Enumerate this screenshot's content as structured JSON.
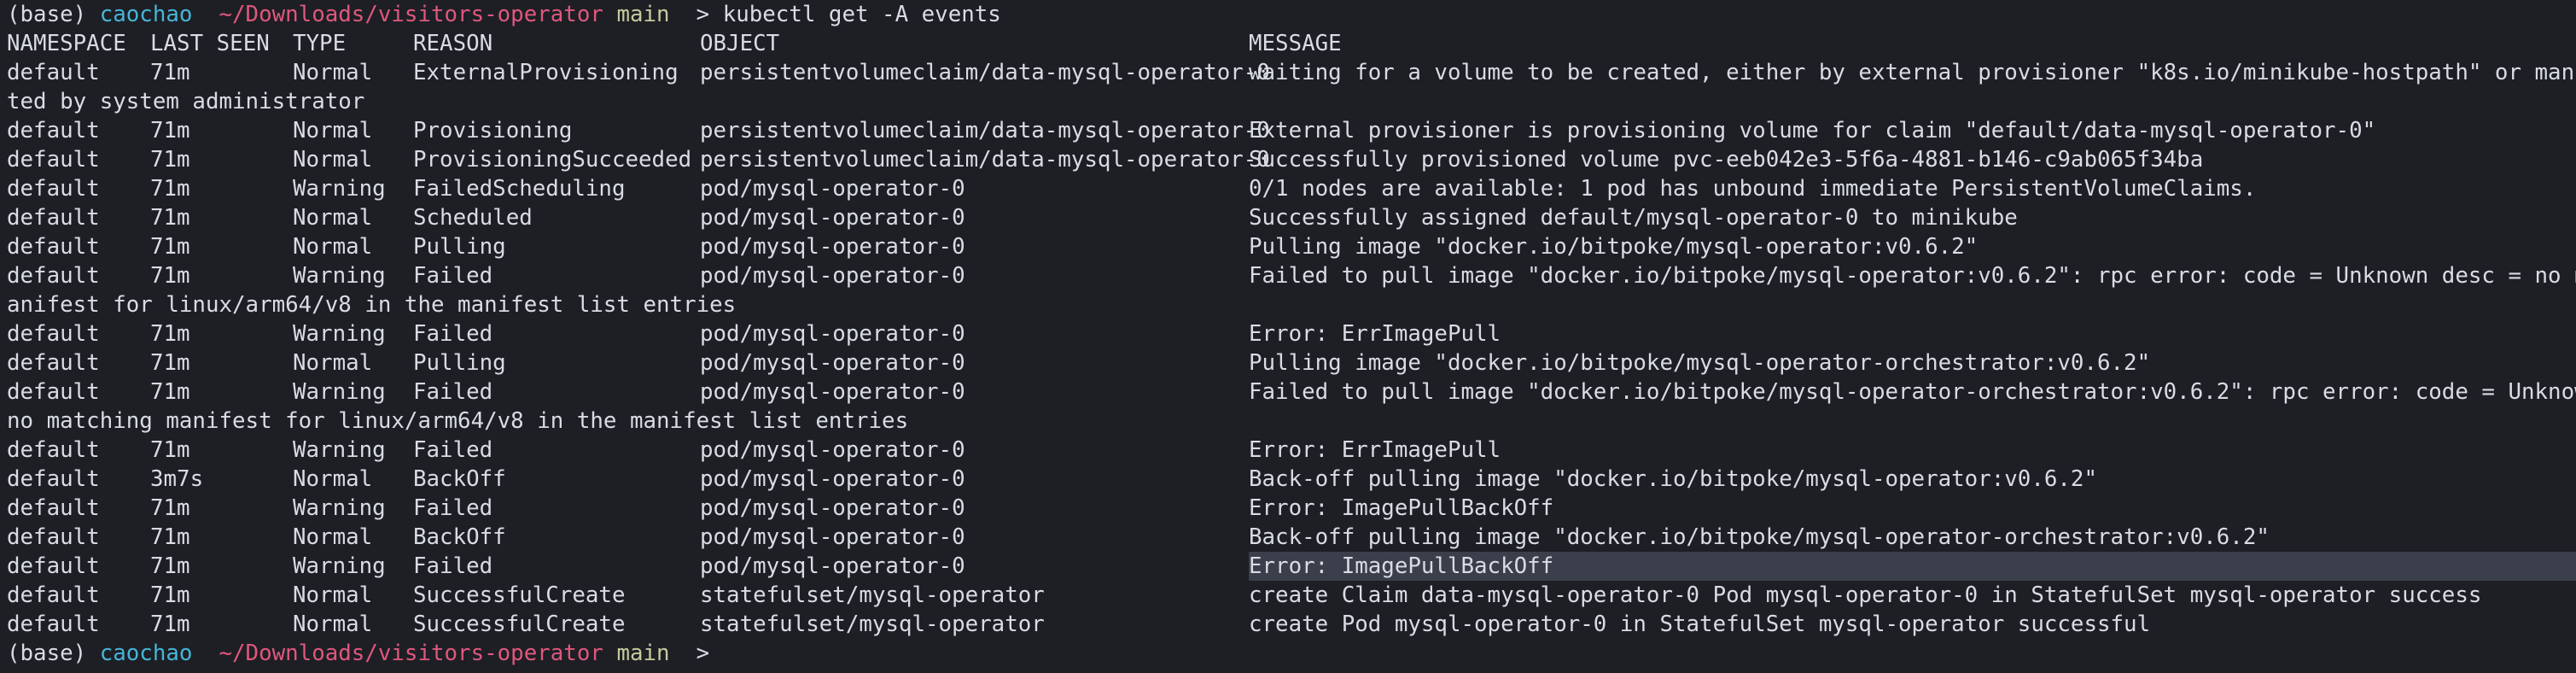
{
  "prompt": {
    "env": "(base)",
    "user": "caochao",
    "path": "~/Downloads/visitors-operator",
    "branch": "main",
    "symbol": ">",
    "command": "kubectl get -A events"
  },
  "headers": {
    "namespace": "NAMESPACE",
    "last_seen": "LAST SEEN",
    "type": "TYPE",
    "reason": "REASON",
    "object": "OBJECT",
    "message": "MESSAGE"
  },
  "rows": [
    {
      "namespace": "default",
      "last_seen": "71m",
      "type": "Normal",
      "reason": "ExternalProvisioning",
      "object": "persistentvolumeclaim/data-mysql-operator-0",
      "message": "waiting for a volume to be created, either by external provisioner \"k8s.io/minikube-hostpath\" or manually crea",
      "wrap": "ted by system administrator"
    },
    {
      "namespace": "default",
      "last_seen": "71m",
      "type": "Normal",
      "reason": "Provisioning",
      "object": "persistentvolumeclaim/data-mysql-operator-0",
      "message": "External provisioner is provisioning volume for claim \"default/data-mysql-operator-0\"",
      "wrap": ""
    },
    {
      "namespace": "default",
      "last_seen": "71m",
      "type": "Normal",
      "reason": "ProvisioningSucceeded",
      "object": "persistentvolumeclaim/data-mysql-operator-0",
      "message": "Successfully provisioned volume pvc-eeb042e3-5f6a-4881-b146-c9ab065f34ba",
      "wrap": ""
    },
    {
      "namespace": "default",
      "last_seen": "71m",
      "type": "Warning",
      "reason": "FailedScheduling",
      "object": "pod/mysql-operator-0",
      "message": "0/1 nodes are available: 1 pod has unbound immediate PersistentVolumeClaims.",
      "wrap": ""
    },
    {
      "namespace": "default",
      "last_seen": "71m",
      "type": "Normal",
      "reason": "Scheduled",
      "object": "pod/mysql-operator-0",
      "message": "Successfully assigned default/mysql-operator-0 to minikube",
      "wrap": ""
    },
    {
      "namespace": "default",
      "last_seen": "71m",
      "type": "Normal",
      "reason": "Pulling",
      "object": "pod/mysql-operator-0",
      "message": "Pulling image \"docker.io/bitpoke/mysql-operator:v0.6.2\"",
      "wrap": ""
    },
    {
      "namespace": "default",
      "last_seen": "71m",
      "type": "Warning",
      "reason": "Failed",
      "object": "pod/mysql-operator-0",
      "message": "Failed to pull image \"docker.io/bitpoke/mysql-operator:v0.6.2\": rpc error: code = Unknown desc = no matching m",
      "wrap": "anifest for linux/arm64/v8 in the manifest list entries"
    },
    {
      "namespace": "default",
      "last_seen": "71m",
      "type": "Warning",
      "reason": "Failed",
      "object": "pod/mysql-operator-0",
      "message": "Error: ErrImagePull",
      "wrap": ""
    },
    {
      "namespace": "default",
      "last_seen": "71m",
      "type": "Normal",
      "reason": "Pulling",
      "object": "pod/mysql-operator-0",
      "message": "Pulling image \"docker.io/bitpoke/mysql-operator-orchestrator:v0.6.2\"",
      "wrap": ""
    },
    {
      "namespace": "default",
      "last_seen": "71m",
      "type": "Warning",
      "reason": "Failed",
      "object": "pod/mysql-operator-0",
      "message": "Failed to pull image \"docker.io/bitpoke/mysql-operator-orchestrator:v0.6.2\": rpc error: code = Unknown desc =",
      "wrap": "no matching manifest for linux/arm64/v8 in the manifest list entries"
    },
    {
      "namespace": "default",
      "last_seen": "71m",
      "type": "Warning",
      "reason": "Failed",
      "object": "pod/mysql-operator-0",
      "message": "Error: ErrImagePull",
      "wrap": ""
    },
    {
      "namespace": "default",
      "last_seen": "3m7s",
      "type": "Normal",
      "reason": "BackOff",
      "object": "pod/mysql-operator-0",
      "message": "Back-off pulling image \"docker.io/bitpoke/mysql-operator:v0.6.2\"",
      "wrap": ""
    },
    {
      "namespace": "default",
      "last_seen": "71m",
      "type": "Warning",
      "reason": "Failed",
      "object": "pod/mysql-operator-0",
      "message": "Error: ImagePullBackOff",
      "wrap": ""
    },
    {
      "namespace": "default",
      "last_seen": "71m",
      "type": "Normal",
      "reason": "BackOff",
      "object": "pod/mysql-operator-0",
      "message": "Back-off pulling image \"docker.io/bitpoke/mysql-operator-orchestrator:v0.6.2\"",
      "wrap": ""
    },
    {
      "namespace": "default",
      "last_seen": "71m",
      "type": "Warning",
      "reason": "Failed",
      "object": "pod/mysql-operator-0",
      "message": "Error: ImagePullBackOff",
      "wrap": "",
      "highlighted": true
    },
    {
      "namespace": "default",
      "last_seen": "71m",
      "type": "Normal",
      "reason": "SuccessfulCreate",
      "object": "statefulset/mysql-operator",
      "message": "create Claim data-mysql-operator-0 Pod mysql-operator-0 in StatefulSet mysql-operator success",
      "wrap": ""
    },
    {
      "namespace": "default",
      "last_seen": "71m",
      "type": "Normal",
      "reason": "SuccessfulCreate",
      "object": "statefulset/mysql-operator",
      "message": "create Pod mysql-operator-0 in StatefulSet mysql-operator successful",
      "wrap": ""
    }
  ],
  "final_prompt": {
    "env": "(base)",
    "user": "caochao",
    "path": "~/Downloads/visitors-operator",
    "branch": "main",
    "symbol": ">"
  }
}
